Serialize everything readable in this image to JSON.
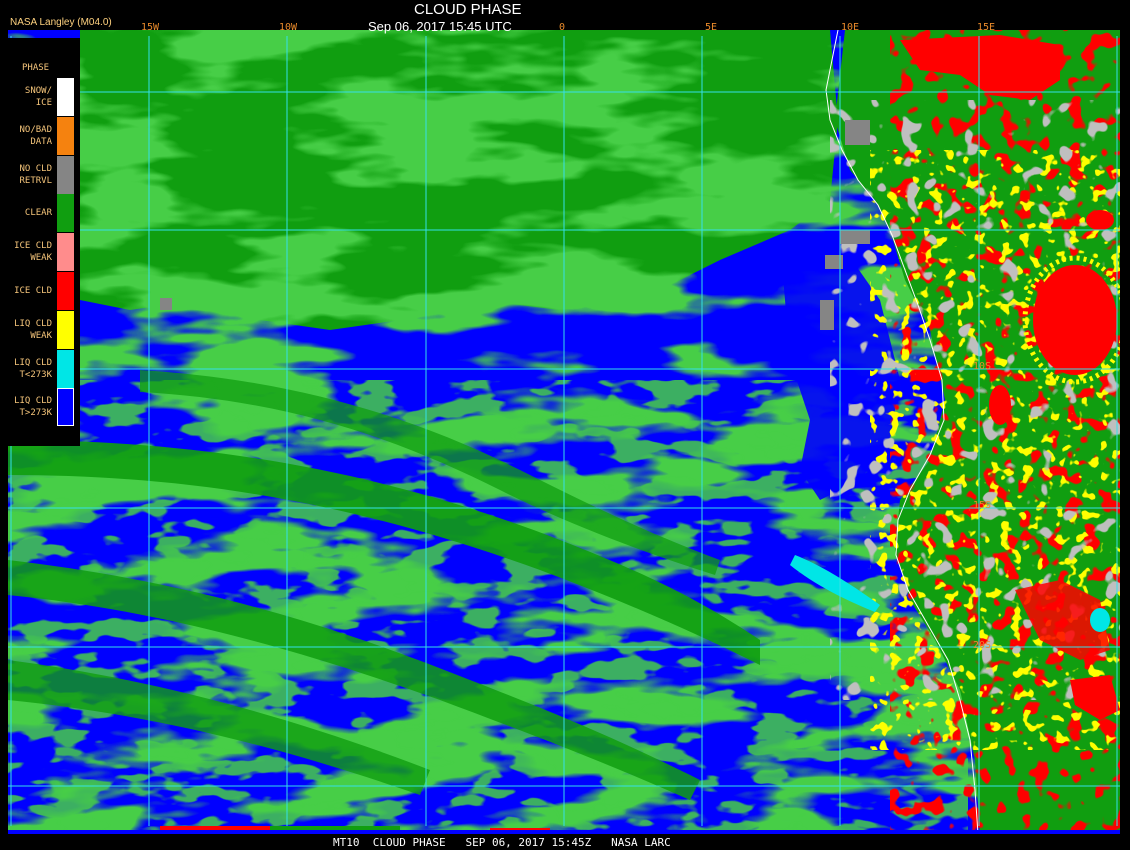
{
  "header": {
    "title": "CLOUD PHASE",
    "subtitle": "Sep 06, 2017 15:45 UTC",
    "agency": "NASA Langley (M04.0)"
  },
  "grid": {
    "longitude_labels": [
      {
        "text": "15W",
        "lon": -15
      },
      {
        "text": "10W",
        "lon": -10
      },
      {
        "text": "0",
        "lon": 0
      },
      {
        "text": "5E",
        "lon": 5
      },
      {
        "text": "10E",
        "lon": 10
      },
      {
        "text": "15E",
        "lon": 15
      }
    ],
    "latitude_labels": [
      {
        "text": "10S",
        "lat": -10
      },
      {
        "text": "15S",
        "lat": -15
      },
      {
        "text": "20S",
        "lat": -20
      }
    ],
    "line_color": "#34e0e8"
  },
  "legend": {
    "heading": "PHASE",
    "items": [
      {
        "label": "SNOW/\nICE",
        "color": "#ffffff"
      },
      {
        "label": "NO/BAD\nDATA",
        "color": "#f5820f"
      },
      {
        "label": "NO CLD\nRETRVL",
        "color": "#858585"
      },
      {
        "label": "CLEAR",
        "color": "#109e10"
      },
      {
        "label": "ICE CLD\nWEAK",
        "color": "#ff8c8c"
      },
      {
        "label": "ICE CLD",
        "color": "#ff0000"
      },
      {
        "label": "LIQ CLD\nWEAK",
        "color": "#ffff00"
      },
      {
        "label": "LIQ CLD\nT<273K",
        "color": "#00e6e6"
      },
      {
        "label": "LIQ CLD\nT>273K",
        "color": "#0000ff"
      }
    ]
  },
  "footer": {
    "text": "MT10  CLOUD PHASE   SEP 06, 2017 15:45Z   NASA LARC"
  }
}
